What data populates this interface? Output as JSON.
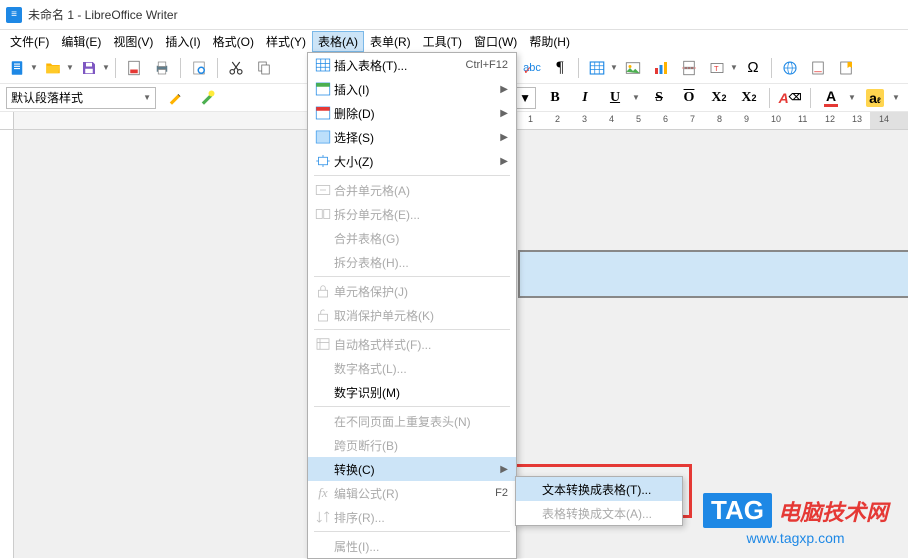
{
  "title": "未命名 1 - LibreOffice Writer",
  "menubar": [
    "文件(F)",
    "编辑(E)",
    "视图(V)",
    "插入(I)",
    "格式(O)",
    "样式(Y)",
    "表格(A)",
    "表单(R)",
    "工具(T)",
    "窗口(W)",
    "帮助(H)"
  ],
  "menubar_active_index": 6,
  "toolbar2": {
    "style": "默认段落样式",
    "font_size": ""
  },
  "format_buttons": [
    "B",
    "I",
    "U",
    "S",
    "O",
    "X²",
    "X₂"
  ],
  "dropdown": {
    "items": [
      {
        "icon": "grid",
        "label": "插入表格(T)...",
        "shortcut": "Ctrl+F12",
        "enabled": true,
        "submenu": false
      },
      {
        "icon": "insert",
        "label": "插入(I)",
        "shortcut": "",
        "enabled": true,
        "submenu": true
      },
      {
        "icon": "delete",
        "label": "删除(D)",
        "shortcut": "",
        "enabled": true,
        "submenu": true
      },
      {
        "icon": "select",
        "label": "选择(S)",
        "shortcut": "",
        "enabled": true,
        "submenu": true
      },
      {
        "icon": "size",
        "label": "大小(Z)",
        "shortcut": "",
        "enabled": true,
        "submenu": true
      },
      {
        "sep": true
      },
      {
        "icon": "merge",
        "label": "合并单元格(A)",
        "shortcut": "",
        "enabled": false,
        "submenu": false
      },
      {
        "icon": "split",
        "label": "拆分单元格(E)...",
        "shortcut": "",
        "enabled": false,
        "submenu": false
      },
      {
        "icon": "",
        "label": "合并表格(G)",
        "shortcut": "",
        "enabled": false,
        "submenu": false
      },
      {
        "icon": "",
        "label": "拆分表格(H)...",
        "shortcut": "",
        "enabled": false,
        "submenu": false
      },
      {
        "sep": true
      },
      {
        "icon": "lock",
        "label": "单元格保护(J)",
        "shortcut": "",
        "enabled": false,
        "submenu": false
      },
      {
        "icon": "unlock",
        "label": "取消保护单元格(K)",
        "shortcut": "",
        "enabled": false,
        "submenu": false
      },
      {
        "sep": true
      },
      {
        "icon": "autofmt",
        "label": "自动格式样式(F)...",
        "shortcut": "",
        "enabled": false,
        "submenu": false
      },
      {
        "icon": "",
        "label": "数字格式(L)...",
        "shortcut": "",
        "enabled": false,
        "submenu": false
      },
      {
        "icon": "",
        "label": "数字识别(M)",
        "shortcut": "",
        "enabled": true,
        "submenu": false
      },
      {
        "sep": true
      },
      {
        "icon": "",
        "label": "在不同页面上重复表头(N)",
        "shortcut": "",
        "enabled": false,
        "submenu": false
      },
      {
        "icon": "",
        "label": "跨页断行(B)",
        "shortcut": "",
        "enabled": false,
        "submenu": false
      },
      {
        "icon": "",
        "label": "转换(C)",
        "shortcut": "",
        "enabled": true,
        "submenu": true,
        "highlight": true
      },
      {
        "icon": "fx",
        "label": "编辑公式(R)",
        "shortcut": "F2",
        "enabled": false,
        "submenu": false
      },
      {
        "icon": "sort",
        "label": "排序(R)...",
        "shortcut": "",
        "enabled": false,
        "submenu": false
      },
      {
        "sep": true
      },
      {
        "icon": "",
        "label": "属性(I)...",
        "shortcut": "",
        "enabled": false,
        "submenu": false
      }
    ]
  },
  "submenu": {
    "items": [
      {
        "label": "文本转换成表格(T)...",
        "enabled": true,
        "highlight": true
      },
      {
        "label": "表格转换成文本(A)...",
        "enabled": false,
        "highlight": false
      }
    ]
  },
  "ruler_labels": [
    "1",
    "2",
    "3",
    "4",
    "5",
    "6",
    "7",
    "8",
    "9",
    "10",
    "11",
    "12",
    "13",
    "14"
  ],
  "watermark": {
    "tag": "TAG",
    "text": "电脑技术网",
    "url": "www.tagxp.com"
  }
}
